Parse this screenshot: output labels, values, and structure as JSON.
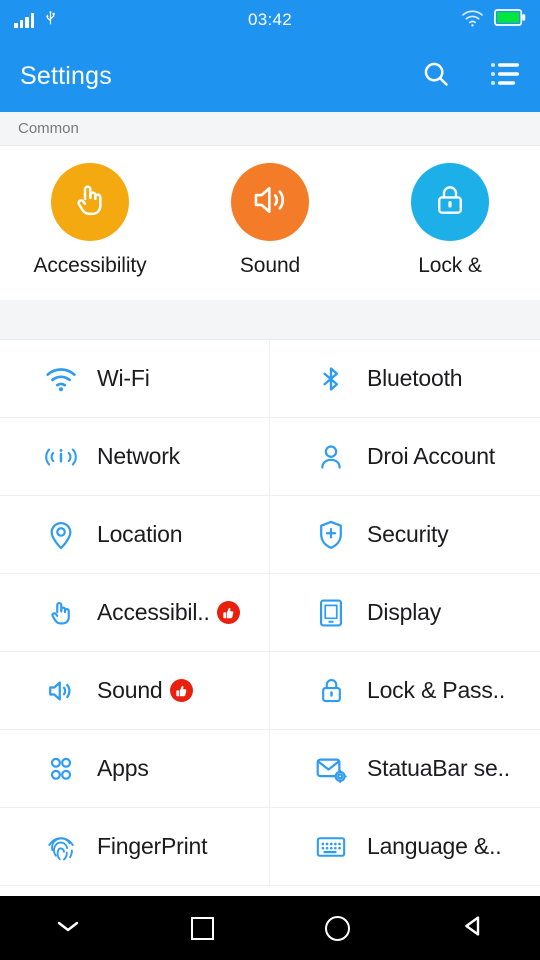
{
  "statusbar": {
    "time": "03:42",
    "left_icons": [
      "signal-bars-icon",
      "usb-icon"
    ],
    "right_icons": [
      "wifi-icon",
      "battery-full-icon"
    ],
    "background": "#1f93f0",
    "battery_color": "#00e63c"
  },
  "appbar": {
    "title": "Settings",
    "search_icon": "search-icon",
    "menu_icon": "list-menu-icon",
    "background": "#1f93f0"
  },
  "section": {
    "header": "Common"
  },
  "shortcuts": [
    {
      "label": "Accessibility",
      "icon": "hand-pointer-icon",
      "color": "#f5a911"
    },
    {
      "label": "Sound",
      "icon": "volume-icon",
      "color": "#f47b27"
    },
    {
      "label": "Lock &",
      "icon": "lock-icon",
      "color": "#1cafe8"
    }
  ],
  "grid_rows": [
    {
      "left": {
        "label": "Wi-Fi",
        "icon": "wifi-icon",
        "badge": false
      },
      "right": {
        "label": "Bluetooth",
        "icon": "bluetooth-icon",
        "badge": false
      }
    },
    {
      "left": {
        "label": "Network",
        "icon": "network-icon",
        "badge": false
      },
      "right": {
        "label": "Droi Account",
        "icon": "account-icon",
        "badge": false
      }
    },
    {
      "left": {
        "label": "Location",
        "icon": "location-pin-icon",
        "badge": false
      },
      "right": {
        "label": "Security",
        "icon": "shield-plus-icon",
        "badge": false
      }
    },
    {
      "left": {
        "label": "Accessibil..",
        "icon": "hand-pointer-icon",
        "badge": true
      },
      "right": {
        "label": "Display",
        "icon": "display-icon",
        "badge": false
      }
    },
    {
      "left": {
        "label": "Sound",
        "icon": "volume-icon",
        "badge": true
      },
      "right": {
        "label": "Lock & Pass..",
        "icon": "lock-icon",
        "badge": false
      }
    },
    {
      "left": {
        "label": "Apps",
        "icon": "apps-grid-icon",
        "badge": false
      },
      "right": {
        "label": "StatuaBar se..",
        "icon": "mail-gear-icon",
        "badge": false
      }
    },
    {
      "left": {
        "label": "FingerPrint",
        "icon": "fingerprint-icon",
        "badge": false
      },
      "right": {
        "label": "Language &..",
        "icon": "keyboard-icon",
        "badge": false
      }
    }
  ],
  "badge": {
    "icon": "thumbs-up-icon",
    "color": "#e8200d"
  },
  "navbar": {
    "buttons": [
      {
        "icon": "chevron-down-icon",
        "name": "hide-keyboard-button"
      },
      {
        "icon": "square-icon",
        "name": "recents-button"
      },
      {
        "icon": "circle-icon",
        "name": "home-button"
      },
      {
        "icon": "triangle-left-icon",
        "name": "back-button"
      }
    ]
  },
  "colors": {
    "accent": "#1f93f0",
    "icon_blue": "#2f9cf4",
    "text_primary": "#1c1c1e",
    "section_bg": "#f4f5f7"
  }
}
